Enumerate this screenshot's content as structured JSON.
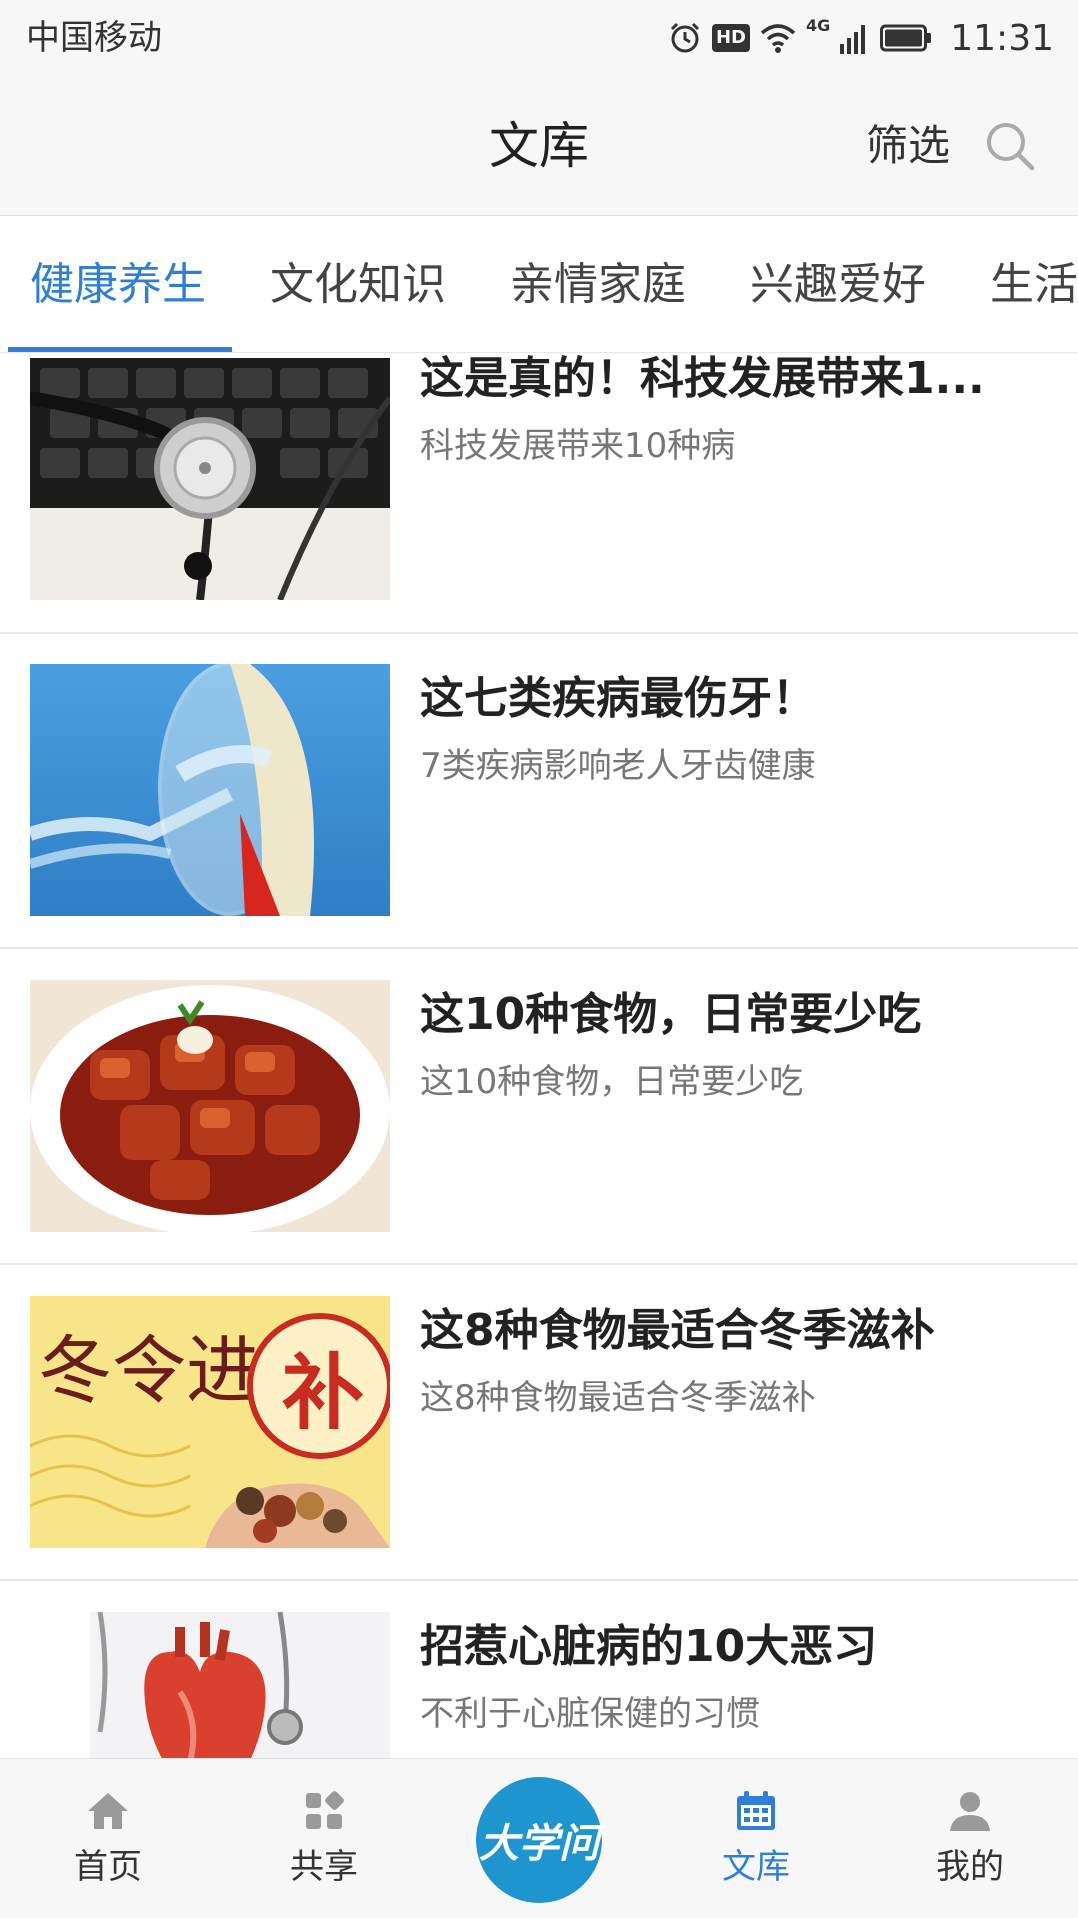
{
  "status_bar": {
    "carrier": "中国移动",
    "network": "4G",
    "hd": "HD",
    "time": "11:31"
  },
  "header": {
    "title": "文库",
    "filter_label": "筛选",
    "search_icon": "search-icon"
  },
  "tabs": [
    {
      "label": "健康养生",
      "active": true
    },
    {
      "label": "文化知识",
      "active": false
    },
    {
      "label": "亲情家庭",
      "active": false
    },
    {
      "label": "兴趣爱好",
      "active": false
    },
    {
      "label": "生活",
      "active": false
    }
  ],
  "articles": [
    {
      "title": "这是真的！科技发展带来1...",
      "subtitle": "科技发展带来10种病",
      "image": "stethoscope-keyboard"
    },
    {
      "title": "这七类疾病最伤牙！",
      "subtitle": "7类疾病影响老人牙齿健康",
      "image": "tooth-water"
    },
    {
      "title": "这10种食物，日常要少吃",
      "subtitle": "这10种食物，日常要少吃",
      "image": "braised-pork"
    },
    {
      "title": "这8种食物最适合冬季滋补",
      "subtitle": "这8种食物最适合冬季滋补",
      "image": "winter-tonic"
    },
    {
      "title": "招惹心脏病的10大恶习",
      "subtitle": "不利于心脏保健的习惯",
      "image": "heart-doctor"
    }
  ],
  "winter_image_text": {
    "calligraphy": "冬令进",
    "seal": "补"
  },
  "bottom_nav": {
    "items": [
      {
        "label": "首页",
        "icon": "home-icon",
        "active": false
      },
      {
        "label": "共享",
        "icon": "apps-icon",
        "active": false
      },
      {
        "label": "文库",
        "icon": "calendar-icon",
        "active": true
      },
      {
        "label": "我的",
        "icon": "person-icon",
        "active": false
      }
    ],
    "center_logo_text": "大学问"
  },
  "colors": {
    "accent": "#2f7fd8",
    "logo": "#1e95cf",
    "bar_bg": "#f7f7f7"
  }
}
